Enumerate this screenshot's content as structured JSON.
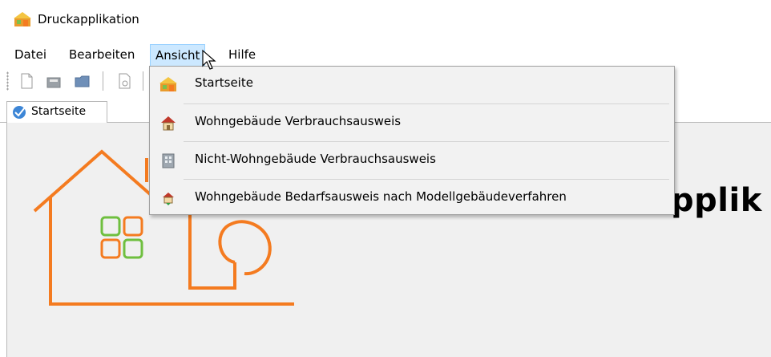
{
  "window": {
    "title": "Druckapplikation",
    "icon": "app-house-icon"
  },
  "menubar": {
    "items": [
      {
        "label": "Datei",
        "active": false
      },
      {
        "label": "Bearbeiten",
        "active": false
      },
      {
        "label": "Ansicht",
        "active": true
      },
      {
        "label": "Hilfe",
        "active": false
      }
    ]
  },
  "toolbar": {
    "buttons": [
      "new-file-icon",
      "save-icon",
      "open-folder-icon",
      "print-preview-icon"
    ]
  },
  "tabs": [
    {
      "label": "Startseite",
      "icon": "globe-check-icon"
    }
  ],
  "content": {
    "title_fragment": "pplik"
  },
  "dropdown": {
    "items": [
      {
        "label": "Startseite",
        "icon": "app-house-icon"
      },
      {
        "label": "Wohngebäude Verbrauchsausweis",
        "icon": "house-icon"
      },
      {
        "label": "Nicht-Wohngebäude Verbrauchsausweis",
        "icon": "building-icon"
      },
      {
        "label": "Wohngebäude Bedarfsausweis nach Modellgebäudeverfahren",
        "icon": "house-arrows-icon"
      }
    ]
  },
  "colors": {
    "menu_highlight": "#cce8ff",
    "logo_orange": "#f47b20",
    "logo_green": "#6fbf3f"
  }
}
